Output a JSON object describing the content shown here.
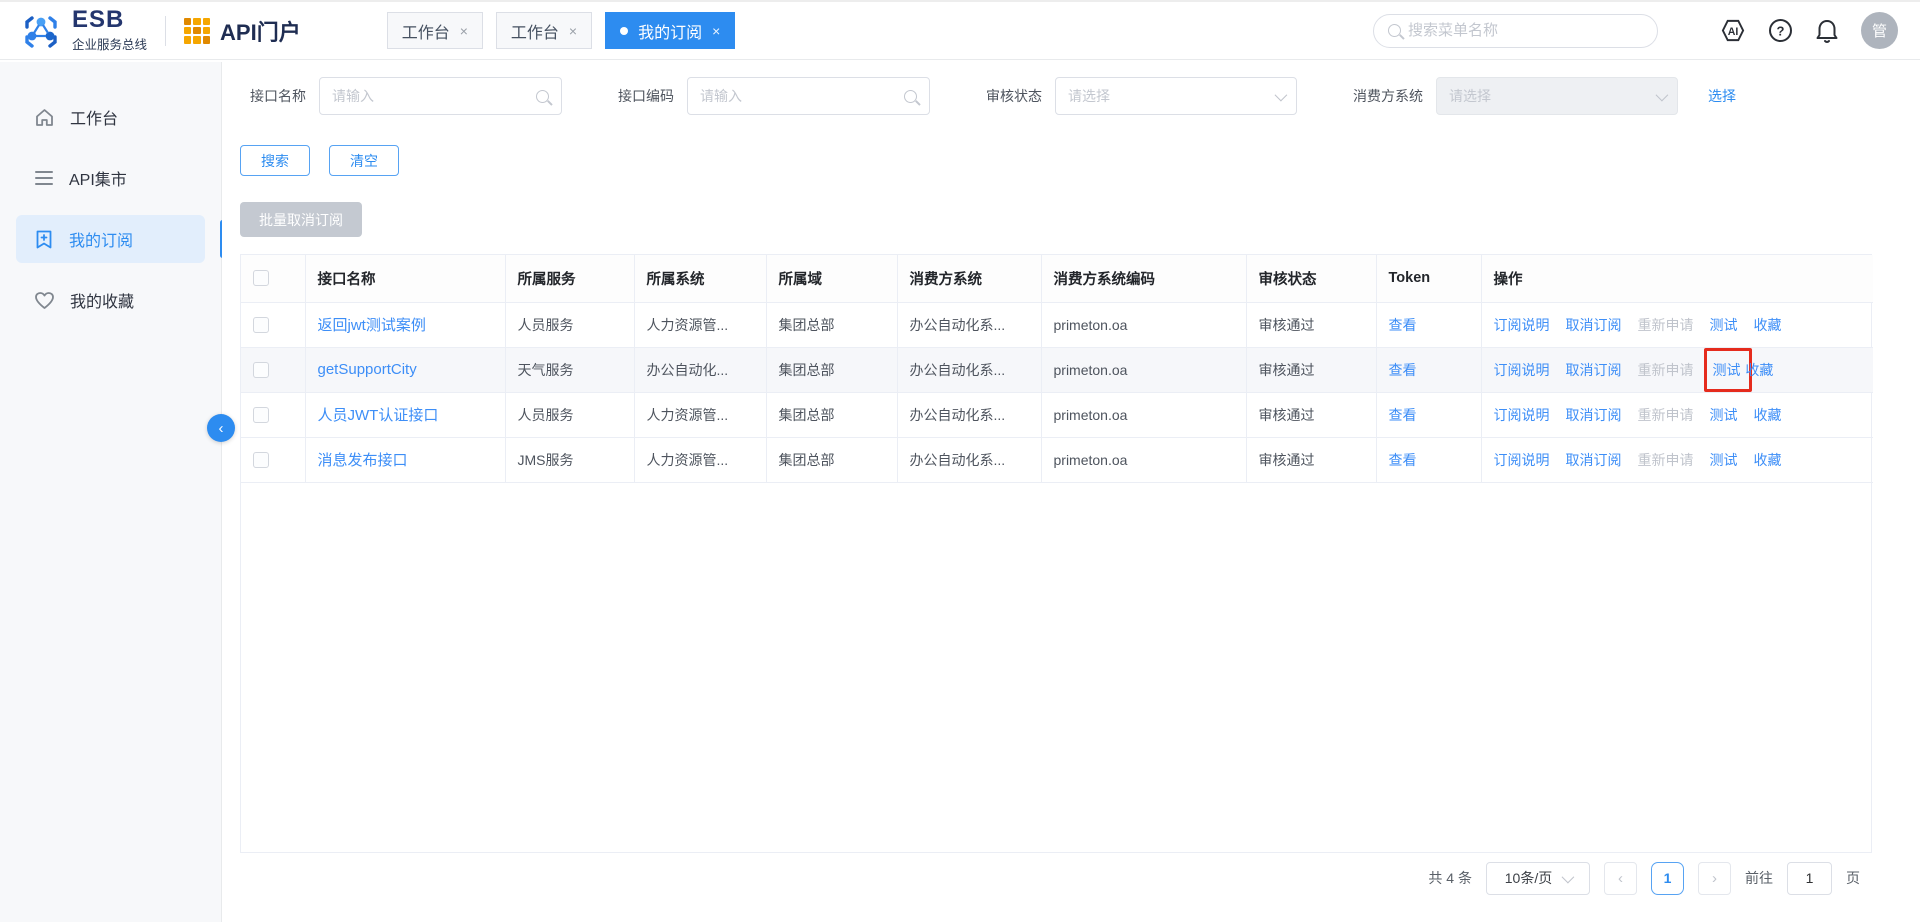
{
  "header": {
    "logo": {
      "title": "ESB",
      "subtitle": "企业服务总线"
    },
    "portal_title": "API门户",
    "tabs": [
      {
        "label": "工作台",
        "active": false
      },
      {
        "label": "工作台",
        "active": false
      },
      {
        "label": "我的订阅",
        "active": true
      }
    ],
    "tab_close": "×",
    "search_placeholder": "搜索菜单名称",
    "icons": [
      "ai-assistant-icon",
      "help-icon",
      "notifications-bell-icon"
    ],
    "avatar_text": "管"
  },
  "sidebar": {
    "items": [
      {
        "label": "工作台",
        "icon": "home-icon",
        "active": false
      },
      {
        "label": "API集市",
        "icon": "menu-list-icon",
        "active": false
      },
      {
        "label": "我的订阅",
        "icon": "bookmark-plus-icon",
        "active": true
      },
      {
        "label": "我的收藏",
        "icon": "heart-icon",
        "active": false
      }
    ],
    "collapse_icon": "‹"
  },
  "filters": {
    "fields": [
      {
        "label": "接口名称",
        "placeholder": "请输入",
        "type": "search-input"
      },
      {
        "label": "接口编码",
        "placeholder": "请输入",
        "type": "search-input"
      },
      {
        "label": "审核状态",
        "placeholder": "请选择",
        "type": "select"
      },
      {
        "label": "消费方系统",
        "placeholder": "请选择",
        "type": "select-disabled"
      }
    ],
    "choose_link": "选择",
    "search_button": "搜索",
    "clear_button": "清空"
  },
  "toolbar": {
    "batch_cancel_button": "批量取消订阅"
  },
  "table": {
    "columns": [
      "接口名称",
      "所属服务",
      "所属系统",
      "所属域",
      "消费方系统",
      "消费方系统编码",
      "审核状态",
      "Token",
      "操作"
    ],
    "token_link": "查看",
    "actions": [
      {
        "label": "订阅说明",
        "disabled": false
      },
      {
        "label": "取消订阅",
        "disabled": false
      },
      {
        "label": "重新申请",
        "disabled": true
      },
      {
        "label": "测试",
        "disabled": false
      },
      {
        "label": "收藏",
        "disabled": false
      }
    ],
    "annotated_action_index": 3,
    "rows": [
      {
        "name": "返回jwt测试案例",
        "service": "人员服务",
        "system": "人力资源管...",
        "domain": "集团总部",
        "consumer": "办公自动化系...",
        "consumer_code": "primeton.oa",
        "status": "审核通过",
        "highlighted": false
      },
      {
        "name": "getSupportCity",
        "service": "天气服务",
        "system": "办公自动化...",
        "domain": "集团总部",
        "consumer": "办公自动化系...",
        "consumer_code": "primeton.oa",
        "status": "审核通过",
        "highlighted": true
      },
      {
        "name": "人员JWT认证接口",
        "service": "人员服务",
        "system": "人力资源管...",
        "domain": "集团总部",
        "consumer": "办公自动化系...",
        "consumer_code": "primeton.oa",
        "status": "审核通过",
        "highlighted": false
      },
      {
        "name": "消息发布接口",
        "service": "JMS服务",
        "system": "人力资源管...",
        "domain": "集团总部",
        "consumer": "办公自动化系...",
        "consumer_code": "primeton.oa",
        "status": "审核通过",
        "highlighted": false
      }
    ]
  },
  "pagination": {
    "total_text": "共 4 条",
    "page_size": "10条/页",
    "prev": "‹",
    "next": "›",
    "current_page": "1",
    "goto_label": "前往",
    "goto_value": "1",
    "page_unit": "页"
  },
  "colors": {
    "accent_blue": "#2d8cf0",
    "link_blue": "#3d8ef7",
    "disabled_gray": "#c0c4cc",
    "annotation_red": "#e52b1d",
    "sidebar_active_bg": "#e2eefc"
  }
}
